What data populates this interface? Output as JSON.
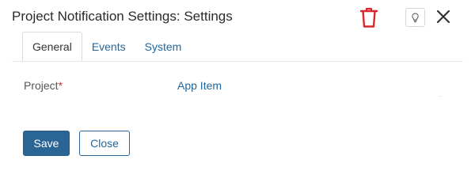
{
  "dialog": {
    "title": "Project Notification Settings: Settings"
  },
  "header_actions": {
    "delete_icon": "trash-icon",
    "help_icon": "lightbulb-icon",
    "close_icon": "close-icon"
  },
  "tabs": [
    {
      "label": "General",
      "active": true
    },
    {
      "label": "Events",
      "active": false
    },
    {
      "label": "System",
      "active": false
    }
  ],
  "form": {
    "project_label": "Project",
    "required_marker": "*",
    "project_value": "App Item"
  },
  "footer": {
    "save_label": "Save",
    "close_label": "Close"
  },
  "colors": {
    "accent": "#2a6596",
    "link": "#21679c",
    "danger": "#d9272e"
  }
}
